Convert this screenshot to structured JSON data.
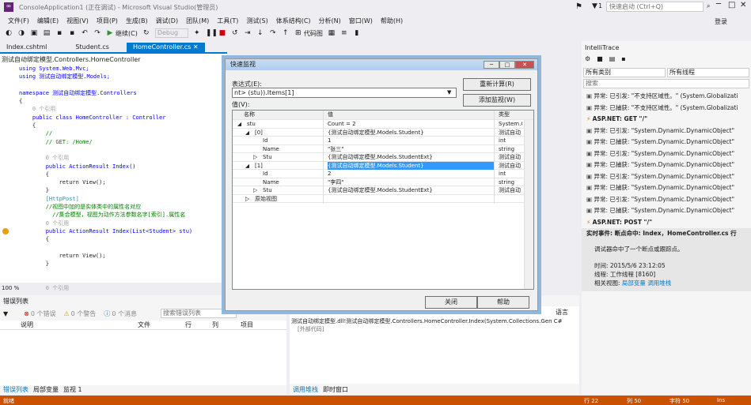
{
  "window": {
    "title": "ConsoleApplication1 (正在调试) - Microsoft Visual Studio(管理员)",
    "quick_launch": "快速启动 (Ctrl+Q)",
    "flag_count": "1",
    "login": "登录"
  },
  "menu": [
    "文件(F)",
    "编辑(E)",
    "视图(V)",
    "项目(P)",
    "生成(B)",
    "调试(D)",
    "团队(M)",
    "工具(T)",
    "测试(S)",
    "体系结构(C)",
    "分析(N)",
    "窗口(W)",
    "帮助(H)"
  ],
  "toolbar": {
    "continue": "继续(C)",
    "config": "Debug",
    "code_map": "代码图"
  },
  "tabs": [
    "Index.cshtml",
    "Student.cs",
    "HomeController.cs"
  ],
  "editor": {
    "crumb": "测试自动绑定模型.Controllers.HomeController",
    "zoom": "100 %",
    "lines": [
      {
        "t": "using System.Web.Mvc;",
        "c": "blue"
      },
      {
        "t": "using 测试自动绑定模型.Models;",
        "c": "blue"
      },
      {
        "t": "",
        "c": ""
      },
      {
        "t": "namespace 测试自动绑定模型.Controllers",
        "c": "blue"
      },
      {
        "t": "{",
        "c": ""
      },
      {
        "t": "    0 个引用",
        "c": "gray"
      },
      {
        "t": "    public class HomeController : Controller",
        "c": "blue"
      },
      {
        "t": "    {",
        "c": ""
      },
      {
        "t": "        //",
        "c": "green"
      },
      {
        "t": "        // GET: /Home/",
        "c": "green"
      },
      {
        "t": "",
        "c": ""
      },
      {
        "t": "        0 个引用",
        "c": "gray"
      },
      {
        "t": "        public ActionResult Index()",
        "c": "blue"
      },
      {
        "t": "        {",
        "c": ""
      },
      {
        "t": "            return View();",
        "c": ""
      },
      {
        "t": "        }",
        "c": ""
      },
      {
        "t": "        [HttpPost]",
        "c": "teal"
      },
      {
        "t": "        //视图中加的是实体类中的属性名对应",
        "c": "green"
      },
      {
        "t": "          //集合模型，视图为动作方法参数名字[索引].属性名",
        "c": "green"
      },
      {
        "t": "        0 个引用",
        "c": "gray"
      },
      {
        "t": "        public ActionResult Index(List<Student> stu)",
        "c": "blue"
      },
      {
        "t": "        {",
        "c": ""
      },
      {
        "t": "",
        "c": ""
      },
      {
        "t": "            return View();",
        "c": ""
      },
      {
        "t": "        }",
        "c": ""
      },
      {
        "t": "",
        "c": ""
      },
      {
        "t": "",
        "c": ""
      },
      {
        "t": "        0 个引用",
        "c": "gray"
      }
    ]
  },
  "errors": {
    "title": "错误列表",
    "errors": "0 个错误",
    "warnings": "0 个警告",
    "messages": "0 个消息",
    "search": "搜索错误列表",
    "cols": [
      "说明",
      "文件",
      "行",
      "列",
      "项目"
    ],
    "tabs": [
      "错误列表",
      "局部变量",
      "监视 1"
    ]
  },
  "callstack": {
    "lang": "语言",
    "row": "测试自动绑定模型.dll!测试自动绑定模型.Controllers.HomeController.Index(System.Collections.Gen C#",
    "row2": "[外部代码]",
    "tabs": [
      "调用堆栈",
      "即时窗口"
    ]
  },
  "dialog": {
    "title": "快速监视",
    "expr_label": "表达式(E):",
    "expr": "nt> (stu)).Items[1]",
    "recalc": "重新计算(R)",
    "add_watch": "添加监视(W)",
    "value_label": "值(V):",
    "cols": [
      "名称",
      "值",
      "类型"
    ],
    "close": "关闭",
    "help": "帮助",
    "rows": [
      {
        "ind": 0,
        "exp": "◢",
        "name": "stu",
        "value": "Count = 2",
        "type": "System.C",
        "sel": false
      },
      {
        "ind": 1,
        "exp": "◢",
        "name": "[0]",
        "value": "{测试自动绑定模型.Models.Student}",
        "type": "测试自动",
        "sel": false
      },
      {
        "ind": 2,
        "exp": "",
        "name": "Id",
        "value": "1",
        "type": "int",
        "sel": false
      },
      {
        "ind": 2,
        "exp": "",
        "name": "Name",
        "value": "\"张三\"",
        "type": "string",
        "sel": false
      },
      {
        "ind": 2,
        "exp": "▷",
        "name": "Stu",
        "value": "{测试自动绑定模型.Models.StudentExt}",
        "type": "测试自动",
        "sel": false
      },
      {
        "ind": 1,
        "exp": "◢",
        "name": "[1]",
        "value": "{测试自动绑定模型.Models.Student}",
        "type": "测试自动",
        "sel": true
      },
      {
        "ind": 2,
        "exp": "",
        "name": "Id",
        "value": "2",
        "type": "int",
        "sel": false
      },
      {
        "ind": 2,
        "exp": "",
        "name": "Name",
        "value": "\"李四\"",
        "type": "string",
        "sel": false
      },
      {
        "ind": 2,
        "exp": "▷",
        "name": "Stu",
        "value": "{测试自动绑定模型.Models.StudentExt}",
        "type": "测试自动",
        "sel": false
      },
      {
        "ind": 1,
        "exp": "▷",
        "name": "原始视图",
        "value": "",
        "type": "",
        "sel": false
      }
    ]
  },
  "intellitrace": {
    "title": "IntelliTrace",
    "filter1": "所有类别",
    "filter2": "所有线程",
    "search": "搜索",
    "events": [
      "异常: 已引发: \"不支持区域性。\" (System.Globalizati",
      "异常: 已捕获: \"不支持区域性。\" (System.Globalizati",
      "ASP.NET: GET \"/\"",
      "异常: 已引发: \"System.Dynamic.DynamicObject\"",
      "异常: 已捕获: \"System.Dynamic.DynamicObject\"",
      "异常: 已引发: \"System.Dynamic.DynamicObject\"",
      "异常: 已捕获: \"System.Dynamic.DynamicObject\"",
      "异常: 已引发: \"System.Dynamic.DynamicObject\"",
      "异常: 已捕获: \"System.Dynamic.DynamicObject\"",
      "异常: 已引发: \"System.Dynamic.DynamicObject\"",
      "异常: 已捕获: \"System.Dynamic.DynamicObject\"",
      "ASP.NET: POST \"/\""
    ],
    "live": "实时事件: 断点命中: Index，HomeController.cs 行",
    "hit": "调试器命中了一个断点或跟踪点。",
    "time": "时间: 2015/5/6 23:12:05",
    "thread": "线程: 工作线程 [8160]",
    "related": "相关视图:",
    "locals": "局部变量",
    "callstack": "调用堆栈"
  },
  "status": {
    "ready": "就绪",
    "line": "行 22",
    "col": "列 50",
    "char": "字符 50",
    "ins": "Ins"
  }
}
